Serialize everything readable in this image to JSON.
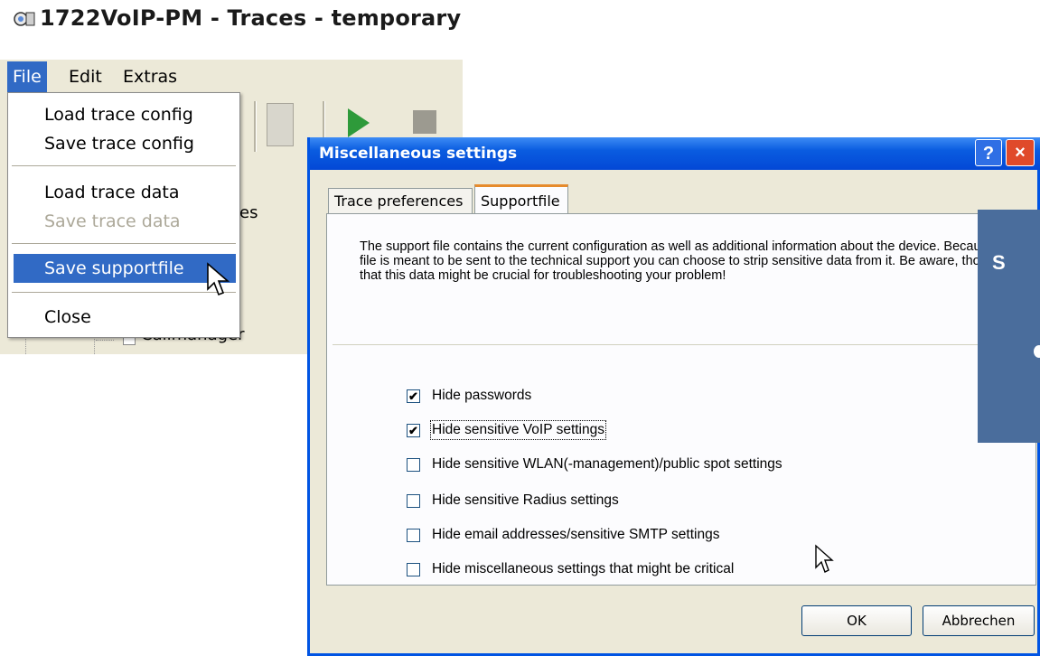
{
  "app": {
    "title": "1722VoIP-PM - Traces - temporary ( ",
    "menus": [
      {
        "label": "File"
      },
      {
        "label": "Edit"
      },
      {
        "label": "Extras"
      }
    ],
    "tree_fragment": "es",
    "tree_item": "Callmanager"
  },
  "file_menu": {
    "items": [
      {
        "label": "Load trace config"
      },
      {
        "label": "Save trace config"
      },
      {
        "label": "Load trace data"
      },
      {
        "label": "Save trace data",
        "disabled": true
      },
      {
        "label": "Save supportfile",
        "highlighted": true
      },
      {
        "label": "Close"
      }
    ]
  },
  "dialog": {
    "title": "Miscellaneous settings",
    "help_label": "?",
    "close_label": "×",
    "tabs": [
      {
        "label": "Trace preferences"
      },
      {
        "label": "Supportfile",
        "active": true
      }
    ],
    "description": "The support file contains the current configuration as well as additional information about the device. Because the file is meant to be sent to the technical support you can choose to strip sensitive data from it. Be aware, though, that this data might be crucial for troubleshooting your problem!",
    "options": [
      {
        "label": "Hide passwords",
        "checked": true
      },
      {
        "label": "Hide sensitive VoIP settings",
        "checked": true
      },
      {
        "label": "Hide sensitive WLAN(-management)/public spot settings",
        "checked": false
      },
      {
        "label": "Hide sensitive Radius settings",
        "checked": false
      },
      {
        "label": "Hide email addresses/sensitive SMTP settings",
        "checked": false
      },
      {
        "label": "Hide miscellaneous settings that might be critical",
        "checked": false
      }
    ],
    "ok_label": "OK",
    "cancel_label": "Abbrechen"
  },
  "overlay": {
    "text": "S",
    "color": "#4a6d9c"
  },
  "colors": {
    "highlight": "#316ac5",
    "titlebar": "#0a5ce0",
    "dialog_bg": "#ece9d8"
  }
}
